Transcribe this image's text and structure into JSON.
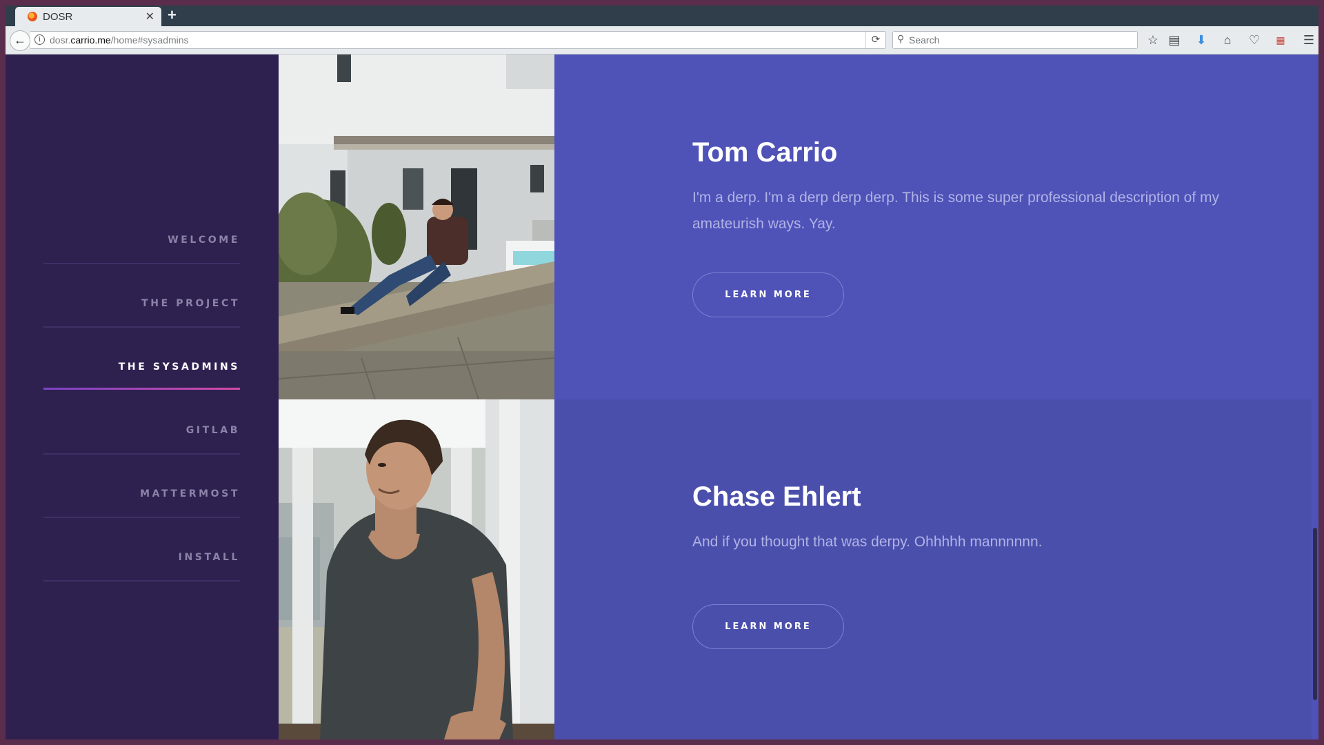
{
  "browser": {
    "tab_title": "DOSR",
    "url_host_pre": "dosr.",
    "url_host": "carrio.me",
    "url_path": "/home#sysadmins",
    "search_placeholder": "Search",
    "icons": [
      "star-icon",
      "reading-list-icon",
      "download-icon",
      "home-icon",
      "pocket-icon",
      "addon-icon",
      "menu-icon"
    ]
  },
  "sidebar": {
    "items": [
      {
        "label": "WELCOME",
        "active": false
      },
      {
        "label": "THE PROJECT",
        "active": false
      },
      {
        "label": "THE SYSADMINS",
        "active": true
      },
      {
        "label": "GITLAB",
        "active": false
      },
      {
        "label": "MATTERMOST",
        "active": false
      },
      {
        "label": "INSTALL",
        "active": false
      }
    ]
  },
  "spotlights": [
    {
      "name": "Tom Carrio",
      "description": "I'm a derp. I'm a derp derp derp. This is some super professional description of my amateurish ways. Yay.",
      "button": "LEARN MORE"
    },
    {
      "name": "Chase Ehlert",
      "description": "And if you thought that was derpy. Ohhhhh mannnnnn.",
      "button": "LEARN MORE"
    }
  ],
  "colors": {
    "sidebar_bg": "#2e2150",
    "spotlight_1_bg": "#4f52b7",
    "spotlight_2_bg": "#4b4fac",
    "active_underline_start": "#7a43c8",
    "active_underline_end": "#d64ba7"
  }
}
